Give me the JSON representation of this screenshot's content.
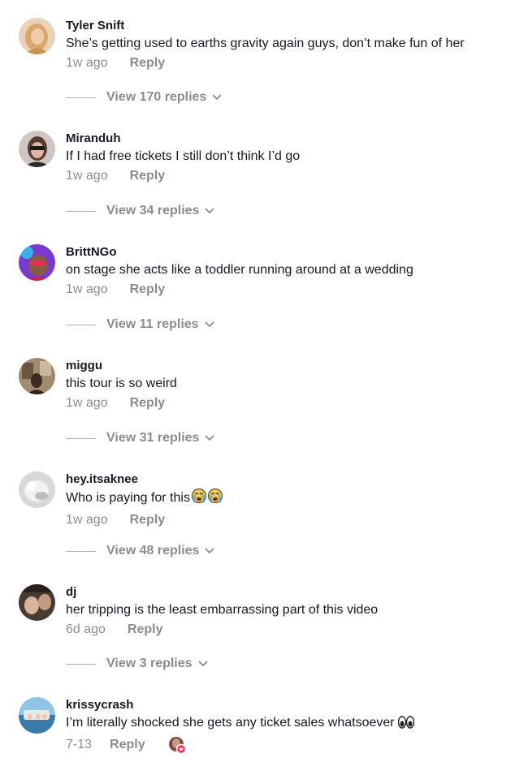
{
  "comments": [
    {
      "username": "Tyler Snift",
      "text": "She’s getting used to earths gravity again guys, don’t make fun of her",
      "time": "1w ago",
      "reply_label": "Reply",
      "view_replies": "View 170 replies",
      "avatar_icon": "user-avatar-blonde"
    },
    {
      "username": "Miranduh",
      "text": "If I had free tickets I still don’t think I’d go",
      "time": "1w ago",
      "reply_label": "Reply",
      "view_replies": "View 34 replies",
      "avatar_icon": "user-avatar-sunglasses"
    },
    {
      "username": "BrittNGo",
      "text": "on stage she acts like a toddler running around at a wedding",
      "time": "1w ago",
      "reply_label": "Reply",
      "view_replies": "View 11 replies",
      "avatar_icon": "user-avatar-purple"
    },
    {
      "username": "miggu",
      "text": "this tour is so weird",
      "time": "1w ago",
      "reply_label": "Reply",
      "view_replies": "View 31 replies",
      "avatar_icon": "user-avatar-room"
    },
    {
      "username": "hey.itsaknee",
      "text": "Who is paying for this",
      "text_emoji": "loudly-crying-face-emoji x2",
      "time": "1w ago",
      "reply_label": "Reply",
      "view_replies": "View 48 replies",
      "avatar_icon": "user-avatar-cat"
    },
    {
      "username": "dj",
      "text": "her tripping is the least embarrassing part of this video",
      "time": "6d ago",
      "reply_label": "Reply",
      "view_replies": "View 3 replies",
      "avatar_icon": "user-avatar-photo"
    },
    {
      "username": "krissycrash",
      "text": "I’m literally shocked she gets any ticket sales whatsoever",
      "text_emoji": "eyes-emoji",
      "time": "7-13",
      "reply_label": "Reply",
      "avatar_icon": "user-avatar-car",
      "liked_by_creator_icon": "creator-liked-badge-icon"
    }
  ],
  "colors": {
    "text_primary": "#161823",
    "text_secondary": "rgba(22,24,35,0.5)",
    "background": "#ffffff"
  }
}
